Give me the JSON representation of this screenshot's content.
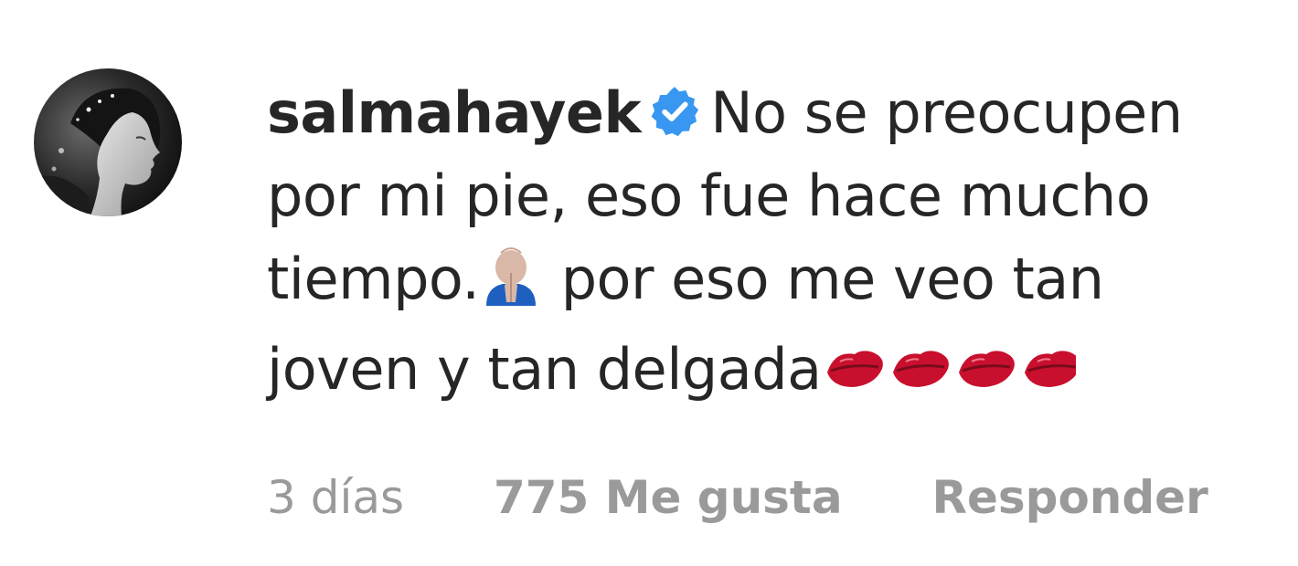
{
  "comment": {
    "username": "salmahayek",
    "verified_icon": "verified-badge-icon",
    "text_part1": "No se preocupen por mi pie, eso fue hace mucho tiempo.",
    "emoji1": "person-praying-icon",
    "text_part2": " por eso me veo tan joven y tan delgada",
    "emoji_tail": "kiss-mark-icons",
    "kiss_count": 4,
    "avatar_icon": "profile-photo-avatar"
  },
  "meta": {
    "time": "3 días",
    "likes": "775 Me gusta",
    "reply": "Responder"
  },
  "colors": {
    "text": "#262626",
    "meta": "#9a9a9a",
    "verified": "#3897f0",
    "kiss": "#c8102e"
  }
}
